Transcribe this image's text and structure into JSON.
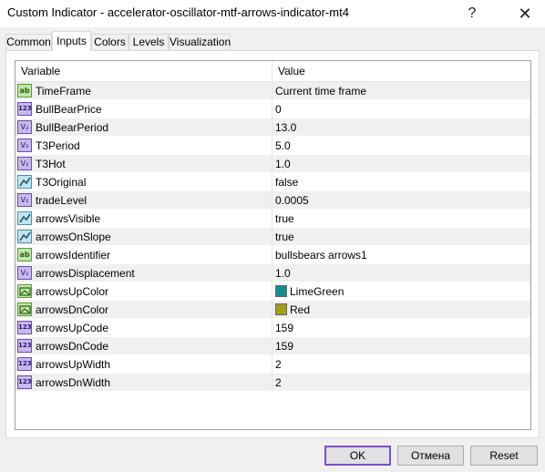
{
  "window": {
    "title": "Custom Indicator - accelerator-oscillator-mtf-arrows-indicator-mt4",
    "help_label": "?",
    "close_label": "✕"
  },
  "tabs": [
    {
      "label": "Common",
      "active": false
    },
    {
      "label": "Inputs",
      "active": true
    },
    {
      "label": "Colors",
      "active": false
    },
    {
      "label": "Levels",
      "active": false
    },
    {
      "label": "Visualization",
      "active": false
    }
  ],
  "grid": {
    "columns": [
      "Variable",
      "Value"
    ],
    "rows": [
      {
        "icon": "ab",
        "variable": "TimeFrame",
        "value": "Current time frame"
      },
      {
        "icon": "n123",
        "variable": "BullBearPrice",
        "value": "0"
      },
      {
        "icon": "va",
        "variable": "BullBearPeriod",
        "value": "13.0"
      },
      {
        "icon": "va",
        "variable": "T3Period",
        "value": "5.0"
      },
      {
        "icon": "va",
        "variable": "T3Hot",
        "value": "1.0"
      },
      {
        "icon": "bool",
        "variable": "T3Original",
        "value": "false"
      },
      {
        "icon": "va",
        "variable": "tradeLevel",
        "value": "0.0005"
      },
      {
        "icon": "bool",
        "variable": "arrowsVisible",
        "value": "true"
      },
      {
        "icon": "bool",
        "variable": "arrowsOnSlope",
        "value": "true"
      },
      {
        "icon": "ab",
        "variable": "arrowsIdentifier",
        "value": "bullsbears arrows1"
      },
      {
        "icon": "va",
        "variable": "arrowsDisplacement",
        "value": "1.0"
      },
      {
        "icon": "color",
        "variable": "arrowsUpColor",
        "value": "LimeGreen",
        "swatch": "#138d8d"
      },
      {
        "icon": "color",
        "variable": "arrowsDnColor",
        "value": "Red",
        "swatch": "#a0a012"
      },
      {
        "icon": "n123",
        "variable": "arrowsUpCode",
        "value": "159"
      },
      {
        "icon": "n123",
        "variable": "arrowsDnCode",
        "value": "159"
      },
      {
        "icon": "n123",
        "variable": "arrowsUpWidth",
        "value": "2"
      },
      {
        "icon": "n123",
        "variable": "arrowsDnWidth",
        "value": "2"
      }
    ]
  },
  "buttons": {
    "ok": "OK",
    "cancel": "Отмена",
    "reset": "Reset"
  },
  "icon_text": {
    "ab": "ab",
    "n123": "123",
    "va": "V₂"
  }
}
